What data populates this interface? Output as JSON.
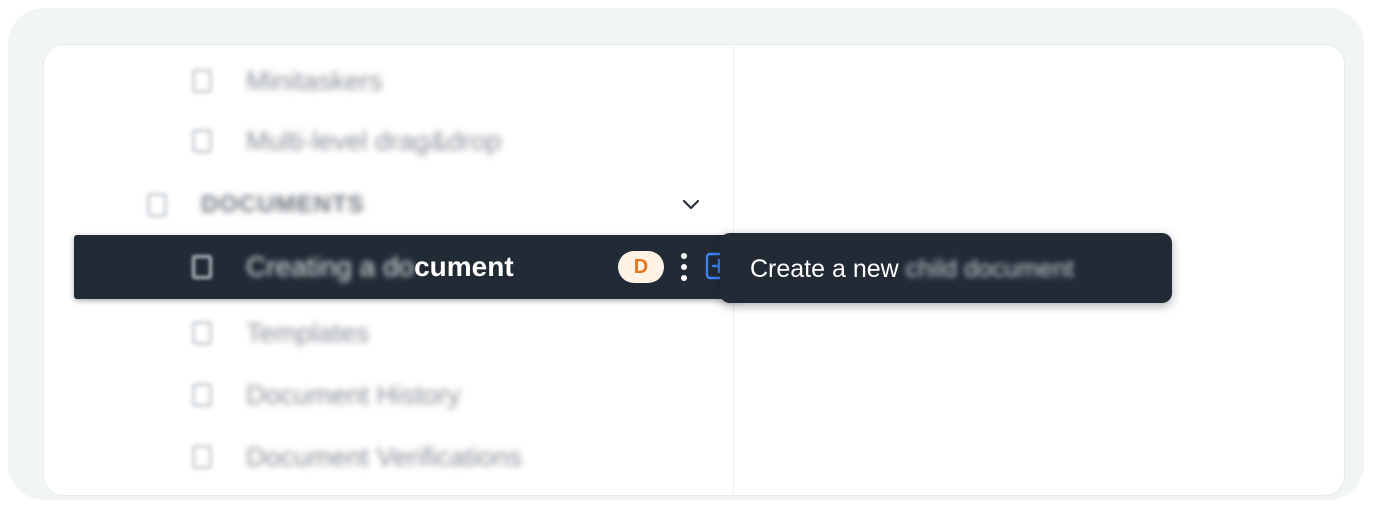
{
  "sidebar": {
    "items_above": [
      {
        "label": "Minitaskers"
      },
      {
        "label": "Multi-level drag&drop"
      }
    ],
    "section": {
      "label": "DOCUMENTS",
      "chevron_icon": "chevron-down-icon"
    },
    "active_item": {
      "label_blurred": "Creating a do",
      "label_sharp": "cument",
      "avatar_initial": "D",
      "more_icon": "more-vertical-icon",
      "add_icon": "plus-square-icon"
    },
    "items_below": [
      {
        "label": "Templates"
      },
      {
        "label": "Document History"
      },
      {
        "label": "Document Verifications"
      }
    ]
  },
  "tooltip": {
    "text_clear": "Create a new ",
    "text_blurred": "child document"
  },
  "colors": {
    "dark_row": "#222a36",
    "avatar_bg": "#fff3e6",
    "avatar_fg": "#e7761c",
    "add_icon": "#3b82f6"
  }
}
